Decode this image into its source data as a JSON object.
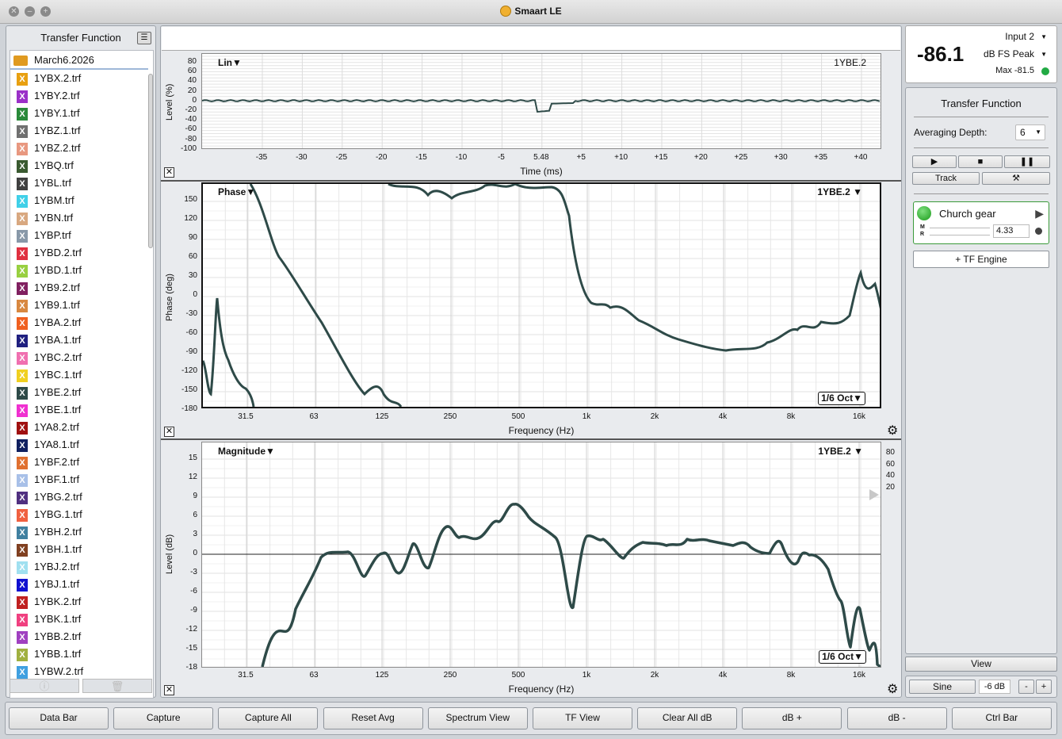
{
  "window": {
    "title": "Smaart LE"
  },
  "sidebar": {
    "title": "Transfer Function",
    "folder": "March6.2026",
    "files": [
      {
        "name": "1YBX.2.trf",
        "color": "#e8a010"
      },
      {
        "name": "1YBY.2.trf",
        "color": "#9b30c8"
      },
      {
        "name": "1YBY.1.trf",
        "color": "#2a8a3a"
      },
      {
        "name": "1YBZ.1.trf",
        "color": "#707070"
      },
      {
        "name": "1YBZ.2.trf",
        "color": "#e89880"
      },
      {
        "name": "1YBQ.trf",
        "color": "#3a5a30"
      },
      {
        "name": "1YBL.trf",
        "color": "#404040"
      },
      {
        "name": "1YBM.trf",
        "color": "#40d0e8"
      },
      {
        "name": "1YBN.trf",
        "color": "#d8a880"
      },
      {
        "name": "1YBP.trf",
        "color": "#8898a8"
      },
      {
        "name": "1YBD.2.trf",
        "color": "#e03040"
      },
      {
        "name": "1YBD.1.trf",
        "color": "#98d040"
      },
      {
        "name": "1YB9.2.trf",
        "color": "#802060"
      },
      {
        "name": "1YB9.1.trf",
        "color": "#d88840"
      },
      {
        "name": "1YBA.2.trf",
        "color": "#f06020"
      },
      {
        "name": "1YBA.1.trf",
        "color": "#202080"
      },
      {
        "name": "1YBC.2.trf",
        "color": "#f070b0"
      },
      {
        "name": "1YBC.1.trf",
        "color": "#f0d020"
      },
      {
        "name": "1YBE.2.trf",
        "color": "#2e4a48"
      },
      {
        "name": "1YBE.1.trf",
        "color": "#f030d0"
      },
      {
        "name": "1YA8.2.trf",
        "color": "#a01010"
      },
      {
        "name": "1YA8.1.trf",
        "color": "#102060"
      },
      {
        "name": "1YBF.2.trf",
        "color": "#e07030"
      },
      {
        "name": "1YBF.1.trf",
        "color": "#a8c0e8"
      },
      {
        "name": "1YBG.2.trf",
        "color": "#503080"
      },
      {
        "name": "1YBG.1.trf",
        "color": "#f06040"
      },
      {
        "name": "1YBH.2.trf",
        "color": "#4080a0"
      },
      {
        "name": "1YBH.1.trf",
        "color": "#804020"
      },
      {
        "name": "1YBJ.2.trf",
        "color": "#a0e0f0"
      },
      {
        "name": "1YBJ.1.trf",
        "color": "#1010d0"
      },
      {
        "name": "1YBK.2.trf",
        "color": "#c02020"
      },
      {
        "name": "1YBK.1.trf",
        "color": "#f04080"
      },
      {
        "name": "1YBB.2.trf",
        "color": "#a040c0"
      },
      {
        "name": "1YBB.1.trf",
        "color": "#a0b040"
      },
      {
        "name": "1YBW.2.trf",
        "color": "#40a0e0"
      }
    ],
    "footer": {
      "info_icon": "info-icon",
      "trash_icon": "trash-icon"
    }
  },
  "lin_plot": {
    "title": "Lin▼",
    "trace": "1YBE.2",
    "ylabel": "Level (%)",
    "xlabel": "Time (ms)",
    "yticks": [
      "80",
      "60",
      "40",
      "20",
      "0",
      "-20",
      "-40",
      "-60",
      "-80",
      "-100"
    ],
    "xticks": [
      "-35",
      "-30",
      "-25",
      "-20",
      "-15",
      "-10",
      "-5",
      "5.48",
      "+5",
      "+10",
      "+15",
      "+20",
      "+25",
      "+30",
      "+35",
      "+40"
    ]
  },
  "phase_plot": {
    "title": "Phase▼",
    "trace": "1YBE.2 ▼",
    "ylabel": "Phase (deg)",
    "xlabel": "Frequency (Hz)",
    "smoothing": "1/6 Oct▼",
    "yticks": [
      "150",
      "120",
      "90",
      "60",
      "30",
      "0",
      "-30",
      "-60",
      "-90",
      "-120",
      "-150",
      "-180"
    ],
    "xticks": [
      "31.5",
      "63",
      "125",
      "250",
      "500",
      "1k",
      "2k",
      "4k",
      "8k",
      "16k"
    ]
  },
  "mag_plot": {
    "title": "Magnitude▼",
    "trace": "1YBE.2 ▼",
    "ylabel": "Level (dB)",
    "xlabel": "Frequency (Hz)",
    "smoothing": "1/6 Oct▼",
    "yticks": [
      "15",
      "12",
      "9",
      "6",
      "3",
      "0",
      "-3",
      "-6",
      "-9",
      "-12",
      "-15",
      "-18"
    ],
    "xticks": [
      "31.5",
      "63",
      "125",
      "250",
      "500",
      "1k",
      "2k",
      "4k",
      "8k",
      "16k"
    ],
    "coh_ticks": [
      "80",
      "60",
      "40",
      "20"
    ]
  },
  "meter": {
    "value": "-86.1",
    "input": "Input 2",
    "mode": "dB FS Peak",
    "max": "Max -81.5",
    "status_color": "#22aa44"
  },
  "tf_panel": {
    "title": "Transfer Function",
    "avg_label": "Averaging Depth:",
    "avg_value": "6",
    "track": "Track",
    "engine_name": "Church gear",
    "delay": "4.33",
    "m_label": "M",
    "r_label": "R",
    "add_engine": "+ TF Engine"
  },
  "right_bottom": {
    "view": "View",
    "sine": "Sine",
    "level": "-6 dB",
    "minus": "-",
    "plus": "+"
  },
  "toolbar": [
    "Data Bar",
    "Capture",
    "Capture All",
    "Reset Avg",
    "Spectrum View",
    "TF View",
    "Clear All dB",
    "dB +",
    "dB -",
    "Ctrl Bar"
  ],
  "trace_color": "#2e4a48"
}
